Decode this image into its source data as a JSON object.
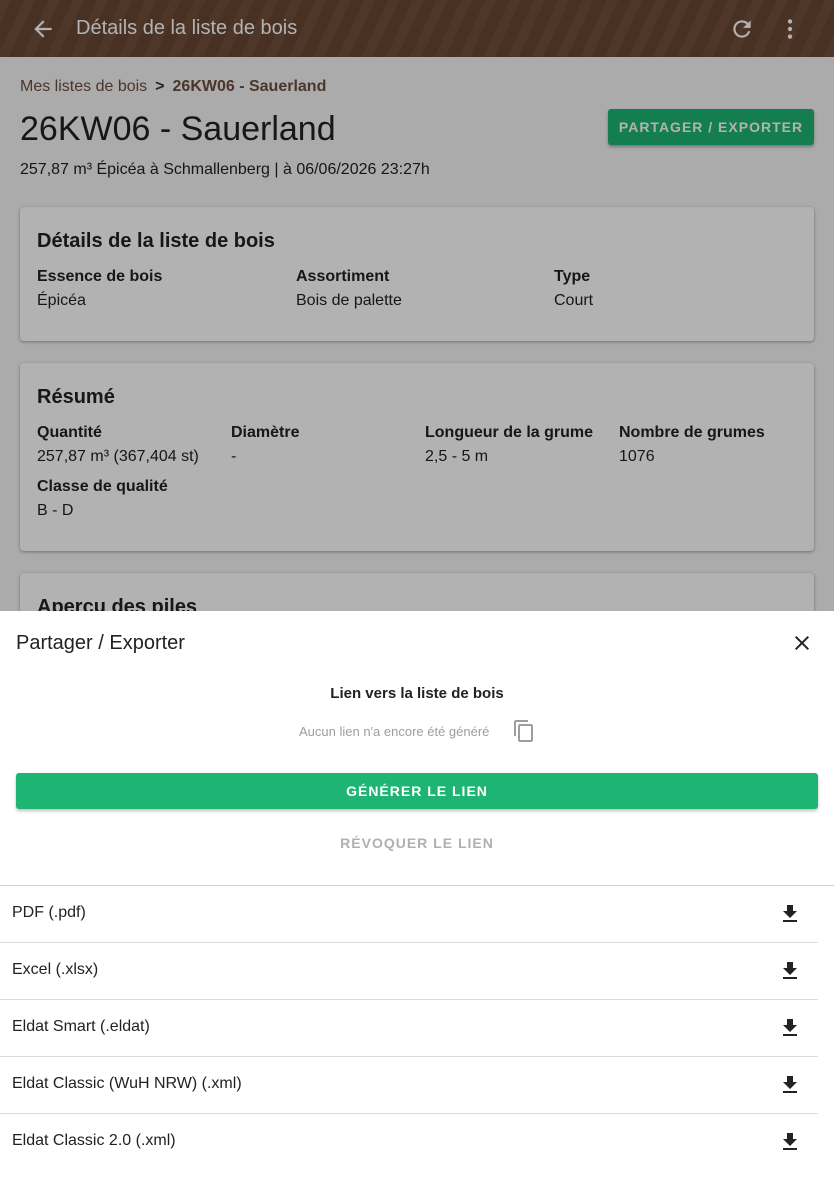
{
  "appbar": {
    "title": "Détails de la liste de bois",
    "color": "#6b4a35"
  },
  "breadcrumb": {
    "parent": "Mes listes de bois",
    "separator": ">",
    "current": "26KW06 - Sauerland"
  },
  "header": {
    "title": "26KW06 - Sauerland",
    "subtitle": "257,87 m³ Épicéa à Schmallenberg | à 06/06/2026 23:27h",
    "share_button": "PARTAGER / EXPORTER"
  },
  "details_card": {
    "title": "Détails de la liste de bois",
    "fields": [
      {
        "label": "Essence de bois",
        "value": "Épicéa"
      },
      {
        "label": "Assortiment",
        "value": "Bois de palette"
      },
      {
        "label": "Type",
        "value": "Court"
      }
    ]
  },
  "summary_card": {
    "title": "Résumé",
    "fields": [
      {
        "label": "Quantité",
        "value": "257,87 m³ (367,404 st)"
      },
      {
        "label": "Diamètre",
        "value": "-"
      },
      {
        "label": "Longueur de la grume",
        "value": "2,5 - 5 m"
      },
      {
        "label": "Nombre de grumes",
        "value": "1076"
      },
      {
        "label": "Classe de qualité",
        "value": "B - D"
      }
    ]
  },
  "piles_card": {
    "title": "Aperçu des piles"
  },
  "sheet": {
    "title": "Partager / Exporter",
    "link_heading": "Lien vers la liste de bois",
    "link_status": "Aucun lien n'a encore été généré",
    "generate_button": "GÉNÉRER LE LIEN",
    "revoke_button": "RÉVOQUER LE LIEN",
    "exports": [
      {
        "label": "PDF (.pdf)"
      },
      {
        "label": "Excel (.xlsx)"
      },
      {
        "label": "Eldat Smart (.eldat)"
      },
      {
        "label": "Eldat Classic (WuH NRW) (.xml)"
      },
      {
        "label": "Eldat Classic 2.0 (.xml)"
      }
    ]
  },
  "colors": {
    "accent_green": "#1eb574",
    "breadcrumb_brown": "#6d4c41"
  },
  "icons": [
    "arrow-back-icon",
    "refresh-icon",
    "more-vert-icon",
    "close-icon",
    "copy-icon",
    "download-icon"
  ]
}
